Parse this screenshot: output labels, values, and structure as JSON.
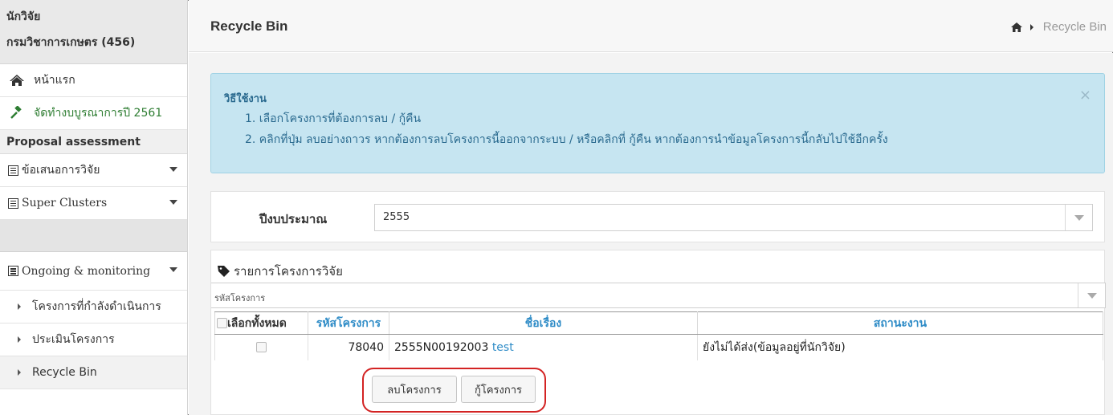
{
  "sidebar": {
    "user_name": "นักวิจัย",
    "user_org": "กรมวิชาการเกษตร (456)",
    "home_label": "หน้าแรก",
    "budget_label": "จัดทำงบบูรณาการปี 2561",
    "section_title": "Proposal assessment",
    "proposal_label": "ข้อเสนอการวิจัย",
    "clusters_label": "Super Clusters",
    "ongoing_label": "Ongoing & monitoring",
    "sub_items": [
      "โครงการที่กำลังดำเนินการ",
      "ประเมินโครงการ",
      "Recycle Bin"
    ]
  },
  "header": {
    "title": "Recycle Bin",
    "breadcrumb": "Recycle Bin"
  },
  "alert": {
    "title": "วิธีใช้งาน",
    "line1": "1. เลือกโครงการที่ต้องการลบ / กู้คืน",
    "line2": "2. คลิกที่ปุ่ม ลบอย่างถาวร หากต้องการลบโครงการนี้ออกจากระบบ / หรือคลิกที่ กู้คืน หากต้องการนำข้อมูลโครงการนี้กลับไปใช้อีกครั้ง",
    "close": "×"
  },
  "filter": {
    "year_label": "ปีงบประมาณ",
    "year_value": "2555"
  },
  "list": {
    "title": "รายการโครงการวิจัย",
    "code_placeholder": "รหัสโครงการ",
    "columns": [
      "เลือกทั้งหมด",
      "รหัสโครงการ",
      "ชื่อเรื่อง",
      "สถานะงาน"
    ],
    "rows": [
      {
        "code": "78040",
        "title_prefix": "2555N00192003",
        "title_link": "test",
        "status": "ยังไม่ได้ส่ง(ข้อมูลอยู่ที่นักวิจัย)"
      }
    ]
  },
  "actions": {
    "delete_label": "ลบโครงการ",
    "restore_label": "กู้โครงการ"
  },
  "colors": {
    "accent_blue": "#2f8cc7",
    "alert_bg": "#c6e5f1",
    "highlight_red": "#d32323",
    "green_link": "#2e7d32"
  }
}
